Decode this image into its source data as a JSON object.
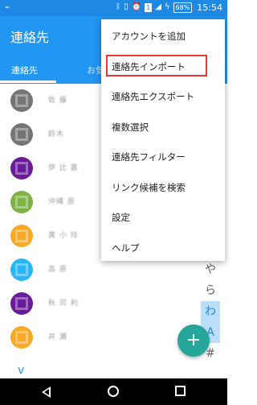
{
  "status_bar": {
    "time": "15:54",
    "battery": "68%",
    "sim_label": "1",
    "icons": [
      "usb-icon",
      "bluetooth-icon",
      "vibrate-icon",
      "alarm-icon",
      "sim-icon",
      "signal-icon",
      "charging-icon",
      "battery-icon"
    ]
  },
  "app": {
    "title": "連絡先",
    "tabs": [
      {
        "label": "連絡先",
        "active": true
      },
      {
        "label": "お気"
      }
    ],
    "accent": "#2196f3",
    "status_color": "#1e88e5"
  },
  "contacts": [
    {
      "name": "佐 藤",
      "color": "#757575"
    },
    {
      "name": "鈴木",
      "color": "#757575"
    },
    {
      "name": "伊 比 嘉",
      "color": "#6a1b9a"
    },
    {
      "name": "沖縄 原",
      "color": "#7cb342"
    },
    {
      "name": "黄 小 玲",
      "color": "#f9a825"
    },
    {
      "name": "高 原",
      "color": "#29b6f6"
    },
    {
      "name": "秋 司 利",
      "color": "#6a1b9a"
    },
    {
      "name": "井 瀬",
      "color": "#f9a825"
    }
  ],
  "index_bar": [
    {
      "label": "や",
      "active": false
    },
    {
      "label": "ら",
      "active": false
    },
    {
      "label": "わ",
      "active": true
    },
    {
      "label": "A",
      "active": true
    },
    {
      "label": "#",
      "active": false
    }
  ],
  "scroll_chevron": "v",
  "fab": {
    "label": "+",
    "color": "#26a69a"
  },
  "menu": {
    "items": [
      {
        "label": "アカウントを追加",
        "highlighted": false
      },
      {
        "label": "連絡先インポート",
        "highlighted": true
      },
      {
        "label": "連絡先エクスポート",
        "highlighted": false
      },
      {
        "label": "複数選択",
        "highlighted": false
      },
      {
        "label": "連絡先フィルター",
        "highlighted": false
      },
      {
        "label": "リンク候補を検索",
        "highlighted": false
      },
      {
        "label": "設定",
        "highlighted": false
      },
      {
        "label": "ヘルプ",
        "highlighted": false
      }
    ],
    "highlight_color": "#e53935"
  },
  "nav_bar": {
    "buttons": [
      "back-icon",
      "home-icon",
      "recents-icon"
    ]
  }
}
